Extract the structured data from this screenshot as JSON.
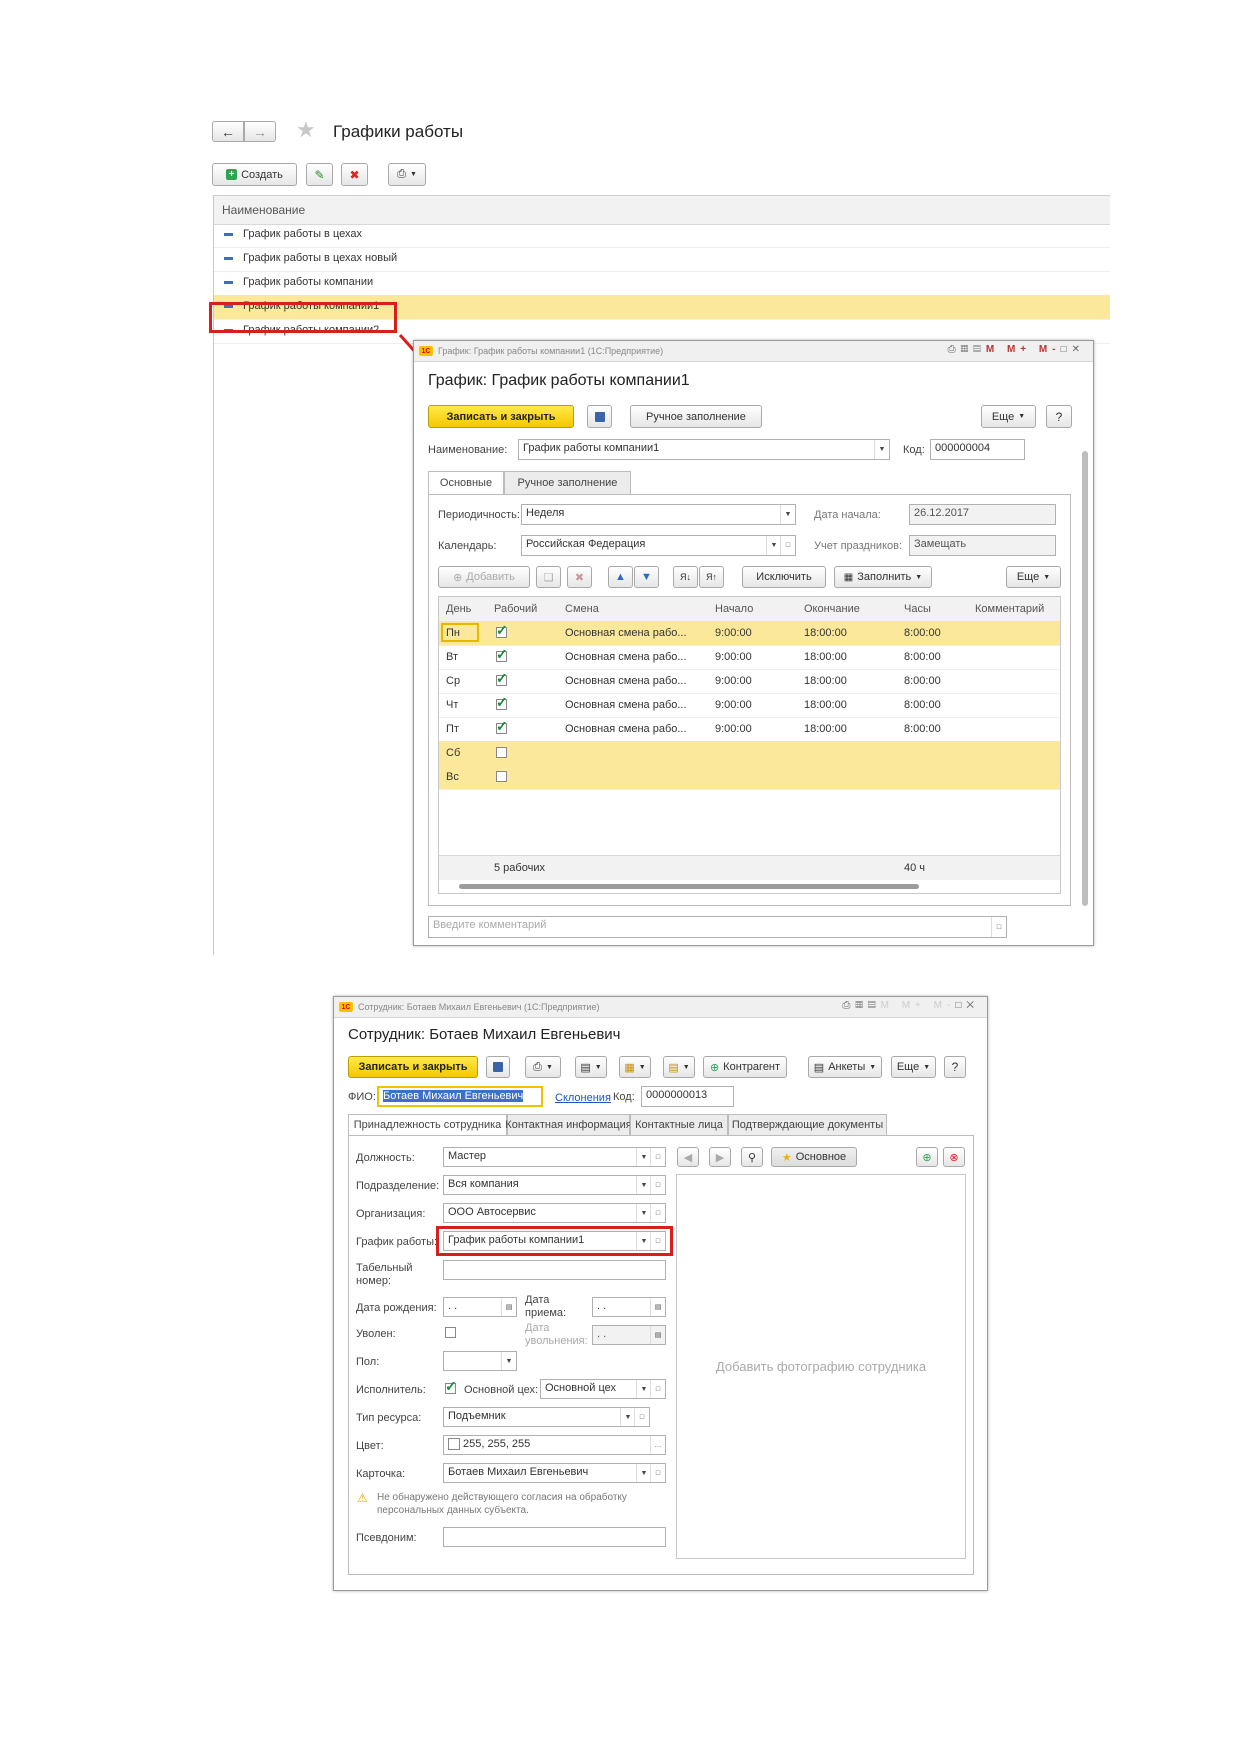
{
  "list": {
    "title": "Графики работы",
    "create_label": "Создать",
    "column_header": "Наименование",
    "items": [
      "График работы в цехах",
      "График работы в цехах новый",
      "График работы компании",
      "График работы компании1",
      "График работы компании2"
    ]
  },
  "schedule": {
    "window_title": "График: График работы компании1 (1С:Предприятие)",
    "heading": "График: График работы компании1",
    "save_close": "Записать и закрыть",
    "manual_fill": "Ручное заполнение",
    "more": "Еще",
    "help": "?",
    "name_label": "Наименование:",
    "name_value": "График работы компании1",
    "code_label": "Код:",
    "code_value": "000000004",
    "tabs": [
      "Основные",
      "Ручное заполнение"
    ],
    "period_label": "Периодичность:",
    "period_value": "Неделя",
    "start_label": "Дата начала:",
    "start_value": "26.12.2017",
    "calendar_label": "Календарь:",
    "calendar_value": "Российская Федерация",
    "holidays_label": "Учет праздников:",
    "holidays_value": "Замещать",
    "add_label": "Добавить",
    "exclude_label": "Исключить",
    "fill_label": "Заполнить",
    "more2": "Еще",
    "grid_headers": [
      "День",
      "Рабочий",
      "Смена",
      "Начало",
      "Окончание",
      "Часы",
      "Комментарий"
    ],
    "rows": [
      {
        "day": "Пн",
        "working": true,
        "shift": "Основная смена рабо...",
        "start": "9:00:00",
        "end": "18:00:00",
        "hours": "8:00:00"
      },
      {
        "day": "Вт",
        "working": true,
        "shift": "Основная смена рабо...",
        "start": "9:00:00",
        "end": "18:00:00",
        "hours": "8:00:00"
      },
      {
        "day": "Ср",
        "working": true,
        "shift": "Основная смена рабо...",
        "start": "9:00:00",
        "end": "18:00:00",
        "hours": "8:00:00"
      },
      {
        "day": "Чт",
        "working": true,
        "shift": "Основная смена рабо...",
        "start": "9:00:00",
        "end": "18:00:00",
        "hours": "8:00:00"
      },
      {
        "day": "Пт",
        "working": true,
        "shift": "Основная смена рабо...",
        "start": "9:00:00",
        "end": "18:00:00",
        "hours": "8:00:00"
      },
      {
        "day": "Сб",
        "working": false,
        "shift": "",
        "start": "",
        "end": "",
        "hours": ""
      },
      {
        "day": "Вс",
        "working": false,
        "shift": "",
        "start": "",
        "end": "",
        "hours": ""
      }
    ],
    "footer_working": "5 рабочих",
    "footer_hours": "40 ч",
    "comment_placeholder": "Введите комментарий"
  },
  "employee": {
    "window_title": "Сотрудник: Ботаев Михаил Евгеньевич (1С:Предприятие)",
    "heading": "Сотрудник: Ботаев Михаил Евгеньевич",
    "save_close": "Записать и закрыть",
    "counterparty": "Контрагент",
    "surveys": "Анкеты",
    "more": "Еще",
    "help": "?",
    "fio_label": "ФИО:",
    "fio_value": "Ботаев Михаил Евгеньевич",
    "declensions": "Склонения",
    "code_label": "Код:",
    "code_value": "0000000013",
    "tabs": [
      "Принадлежность сотрудника",
      "Контактная информация",
      "Контактные лица",
      "Подтверждающие документы"
    ],
    "position_label": "Должность:",
    "position_value": "Мастер",
    "department_label": "Подразделение:",
    "department_value": "Вся компания",
    "org_label": "Организация:",
    "org_value": "ООО Автосервис",
    "schedule_label": "График работы:",
    "schedule_value": "График работы компании1",
    "tabnum_label_1": "Табельный",
    "tabnum_label_2": "номер:",
    "birth_label": "Дата рождения:",
    "date_empty": " .  .",
    "hire_label_1": "Дата",
    "hire_label_2": "приема:",
    "fired_label": "Уволен:",
    "fire_date_label_1": "Дата",
    "fire_date_label_2": "увольнения:",
    "gender_label": "Пол:",
    "executor_label": "Исполнитель:",
    "main_shop_label": "Основной цех:",
    "main_shop_value": "Основной цех",
    "resource_label": "Тип ресурса:",
    "resource_value": "Подъемник",
    "color_label": "Цвет:",
    "color_value": "255, 255, 255",
    "card_label": "Карточка:",
    "card_value": "Ботаев Михаил Евгеньевич",
    "warning_1": "Не обнаружено действующего согласия на обработку",
    "warning_2": "персональных данных субъекта.",
    "alias_label": "Псевдоним:",
    "photo_main": "Основное",
    "photo_placeholder": "Добавить фотографию сотрудника"
  },
  "colors": {
    "highlight": "#d81e1e",
    "selected_row": "#fbe89a",
    "save_button": "#f5c800"
  }
}
